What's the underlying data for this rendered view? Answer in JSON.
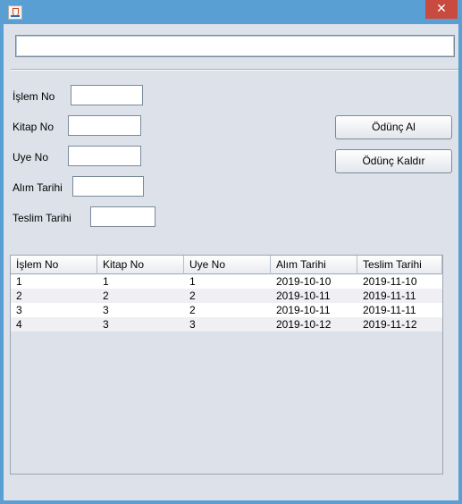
{
  "window": {
    "app_icon": "java-icon",
    "close_glyph": "✕"
  },
  "top_field": {
    "value": ""
  },
  "form": {
    "islem_no": {
      "label": "İşlem No",
      "value": ""
    },
    "kitap_no": {
      "label": "Kitap No",
      "value": ""
    },
    "uye_no": {
      "label": "Uye No",
      "value": ""
    },
    "alim_tarihi": {
      "label": "Alım Tarihi",
      "value": ""
    },
    "teslim_tarihi": {
      "label": "Teslim Tarihi",
      "value": ""
    }
  },
  "buttons": {
    "odunc_al": "Ödünç Al",
    "odunc_kaldir": "Ödünç Kaldır"
  },
  "table": {
    "columns": [
      "İşlem No",
      "Kitap No",
      "Uye No",
      "Alım Tarihi",
      "Teslim Tarihi"
    ],
    "rows": [
      [
        "1",
        "1",
        "1",
        "2019-10-10",
        "2019-11-10"
      ],
      [
        "2",
        "2",
        "2",
        "2019-10-11",
        "2019-11-11"
      ],
      [
        "3",
        "3",
        "2",
        "2019-10-11",
        "2019-11-11"
      ],
      [
        "4",
        "3",
        "3",
        "2019-10-12",
        "2019-11-12"
      ]
    ]
  }
}
